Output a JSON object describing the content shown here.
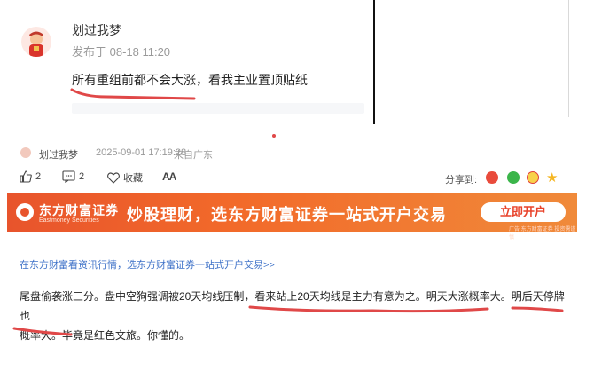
{
  "top_comment": {
    "username": "划过我梦",
    "time": "发布于 08-18 11:20",
    "content": "所有重组前都不会大涨，看我主业置顶贴纸"
  },
  "post": {
    "username": "划过我梦",
    "datetime": "2025-09-01 17:19:28",
    "location": "来自广东"
  },
  "actions": {
    "like_count": "2",
    "comment_count": "2",
    "favorite_label": "收藏",
    "font_label": "AA",
    "share_label": "分享到:"
  },
  "share_icons": [
    "share-app-icon",
    "wechat-icon",
    "weibo-icon",
    "star-icon"
  ],
  "banner": {
    "brand": "东方财富证券",
    "brand_en": "Eastmoney Securities",
    "slogan": "炒股理财，选东方财富证券一站式开户交易",
    "button": "立即开户",
    "tag": "广告 东方财富证券 投资需谨慎"
  },
  "promo_link": "在东方财富看资讯行情，选东方财富证券一站式开户交易>>",
  "body_lines": [
    "尾盘偷袭涨三分。盘中空狗强调被20天均线压制，看来站上20天均线是主力有意为之。明天大涨概率大。明后天停牌也",
    "概率大。毕竟是红色文旅。你懂的。"
  ],
  "colors": {
    "accent_red": "#e04848",
    "banner_orange": "#f26a2a",
    "link_blue": "#3f72c8"
  }
}
